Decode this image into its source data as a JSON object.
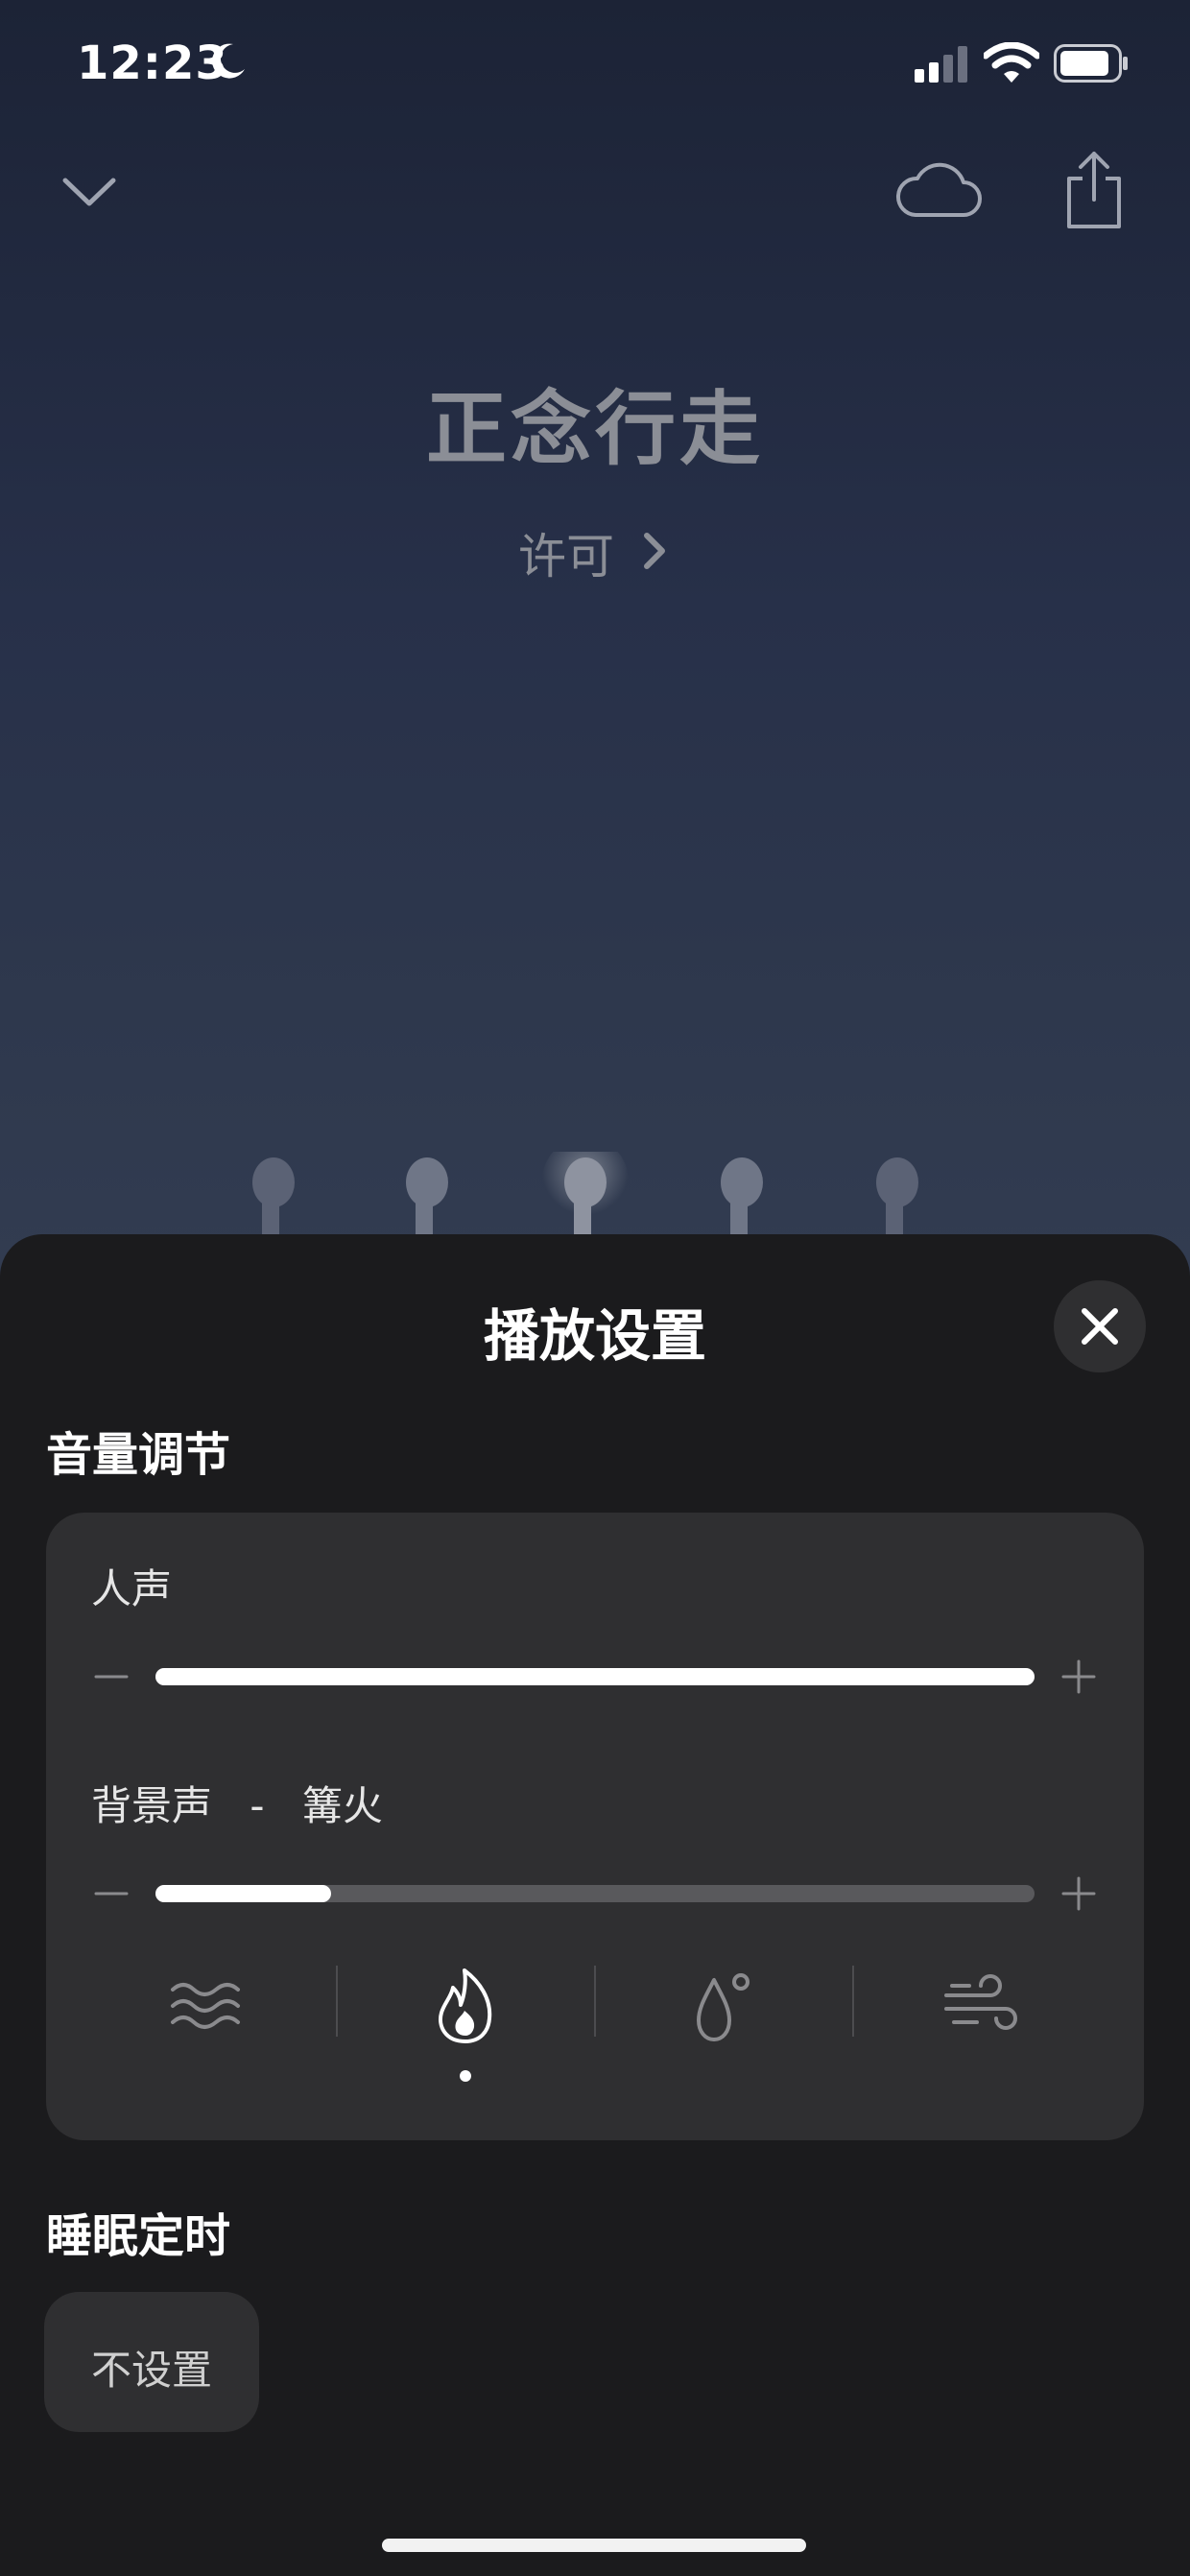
{
  "status_bar": {
    "time": "12:23"
  },
  "player": {
    "title": "正念行走",
    "author": "许可"
  },
  "sheet": {
    "title": "播放设置",
    "volume_section": {
      "heading": "音量调节",
      "voice": {
        "label": "人声",
        "level": 1.0
      },
      "background": {
        "label": "背景声",
        "separator": "-",
        "sound_name": "篝火",
        "level": 0.2
      },
      "sounds": [
        {
          "icon": "waves-icon",
          "selected": false
        },
        {
          "icon": "campfire-icon",
          "selected": true
        },
        {
          "icon": "raindrop-icon",
          "selected": false
        },
        {
          "icon": "wind-icon",
          "selected": false
        }
      ]
    },
    "timer_section": {
      "heading": "睡眠定时",
      "option": "不设置"
    }
  }
}
